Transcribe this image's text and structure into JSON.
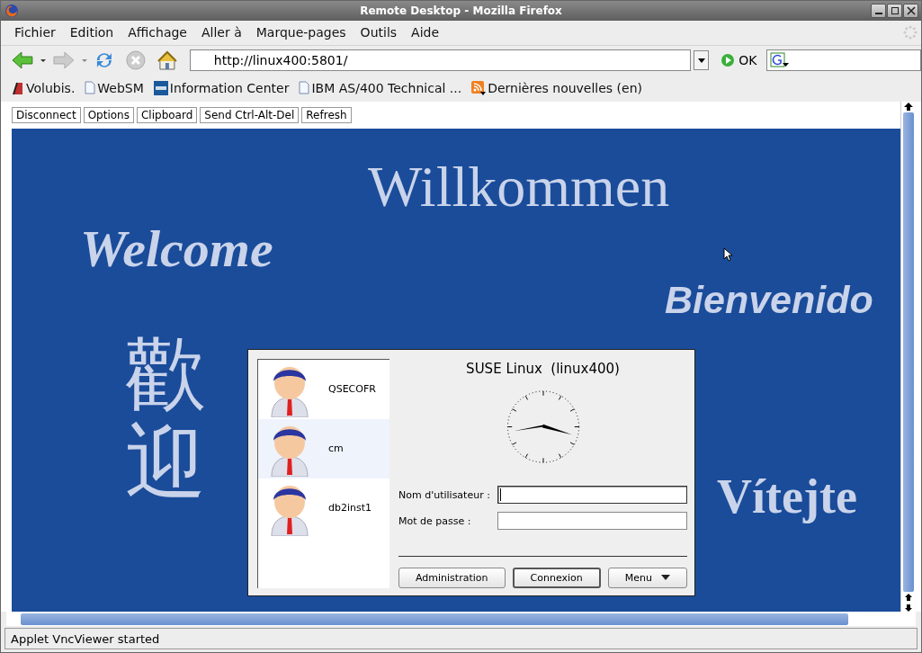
{
  "window": {
    "title": "Remote Desktop - Mozilla Firefox"
  },
  "menu": [
    "Fichier",
    "Edition",
    "Affichage",
    "Aller à",
    "Marque-pages",
    "Outils",
    "Aide"
  ],
  "address": {
    "value": "http://linux400:5801/"
  },
  "go_button": "OK",
  "bookmarks": [
    {
      "label": "Volubis.",
      "kind": "site"
    },
    {
      "label": "WebSM",
      "kind": "page"
    },
    {
      "label": "Information Center",
      "kind": "ibm"
    },
    {
      "label": "IBM AS/400 Technical ...",
      "kind": "page"
    },
    {
      "label": "Dernières nouvelles (en)",
      "kind": "feed"
    }
  ],
  "vnc_buttons": [
    "Disconnect",
    "Options",
    "Clipboard",
    "Send Ctrl-Alt-Del",
    "Refresh"
  ],
  "greetings": [
    {
      "text": "Willkommen",
      "kind": "serif"
    },
    {
      "text": "Welcome",
      "kind": "script"
    },
    {
      "text": "Bienvenido",
      "kind": "sans"
    },
    {
      "text": "歡迎",
      "kind": "vertical"
    },
    {
      "text": "Vítejte",
      "kind": "bold"
    }
  ],
  "login": {
    "title": "SUSE Linux  (linux400)",
    "users": [
      {
        "name": "QSECOFR",
        "selected": false
      },
      {
        "name": "cm",
        "selected": true
      },
      {
        "name": "db2inst1",
        "selected": false
      }
    ],
    "fields": [
      {
        "label": "Nom d'utilisateur :",
        "focused": true
      },
      {
        "label": "Mot de passe :",
        "focused": false
      }
    ],
    "buttons": [
      {
        "label": "Administration",
        "kind": "plain"
      },
      {
        "label": "Connexion",
        "kind": "default"
      },
      {
        "label": "Menu",
        "kind": "dropdown"
      }
    ]
  },
  "status_bar": "Applet VncViewer started"
}
